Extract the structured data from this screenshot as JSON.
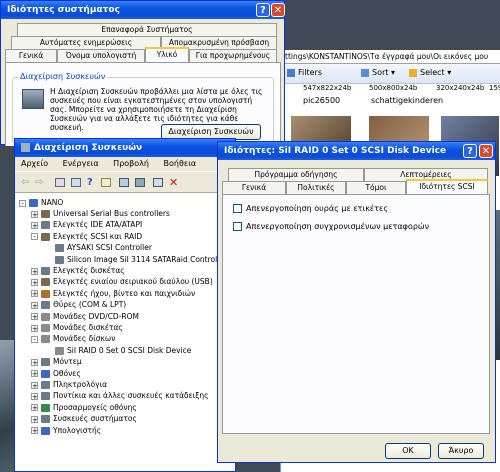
{
  "explorer": {
    "address": "ttings\\KONSTANTINOS\\Τα έγγραφά μου\\Οι εικόνες μου",
    "toolbar": {
      "filters": "Filters",
      "sort": "Sort",
      "select": "Select"
    },
    "thumbs": [
      {
        "size": "547x822x24b",
        "name": "pic26500"
      },
      {
        "size": "500x800x24b",
        "name": "schattigekinderen"
      },
      {
        "size": "320x240x24b",
        "name": ""
      },
      {
        "size": "159x",
        "name": ""
      }
    ]
  },
  "sysprops": {
    "title": "Ιδιότητες συστήματος",
    "tabs_row1": [
      "Επαναφορά Συστήματος"
    ],
    "tabs_row2": [
      "Αυτόματες ενημερώσεις",
      "Απομακρυσμένη πρόσβαση"
    ],
    "tabs_row3": [
      "Γενικά",
      "Όνομα υπολογιστή",
      "Υλικό",
      "Για προχωρημένους"
    ],
    "group_title": "Διαχείριση Συσκευών",
    "group_text": "Η Διαχείριση Συσκευών προβάλλει μια λίστα με όλες τις συσκευές που είναι εγκατεστημένες στον υπολογιστή σας. Μπορείτε να χρησιμοποιήσετε τη Διαχείριση Συσκευών για να αλλάξετε τις ιδιότητες για κάθε συσκευή.",
    "button": "Διαχείριση Συσκευών"
  },
  "devmgr": {
    "title": "Διαχείριση Συσκευών",
    "menu": [
      "Αρχείο",
      "Ενέργεια",
      "Προβολή",
      "Βοήθεια"
    ],
    "root": "NANO",
    "items": [
      {
        "label": "Universal Serial Bus controllers",
        "exp": "+",
        "depth": 1,
        "color": "#7a6a4a"
      },
      {
        "label": "Ελεγκτές IDE ATA/ATAPI",
        "exp": "+",
        "depth": 1,
        "color": "#6a7a8a"
      },
      {
        "label": "Ελεγκτές SCSI και RAID",
        "exp": "-",
        "depth": 1,
        "color": "#7a6a4a"
      },
      {
        "label": "AYSAKI SCSI Controller",
        "exp": "",
        "depth": 2,
        "color": "#6a7a8a"
      },
      {
        "label": "Silicon Image SiI 3114 SATARaid Controller",
        "exp": "",
        "depth": 2,
        "color": "#6a7a8a"
      },
      {
        "label": "Ελεγκτές δισκέτας",
        "exp": "+",
        "depth": 1,
        "color": "#6a7a8a"
      },
      {
        "label": "Ελεγκτές ενιαίου σειριακού διαύλου (USB)",
        "exp": "+",
        "depth": 1,
        "color": "#7a6a4a"
      },
      {
        "label": "Ελεγκτές ήχου, βίντεο και παιχνιδιών",
        "exp": "+",
        "depth": 1,
        "color": "#b0702a"
      },
      {
        "label": "Θύρες (COM & LPT)",
        "exp": "+",
        "depth": 1,
        "color": "#6a7a8a"
      },
      {
        "label": "Μονάδες DVD/CD-ROM",
        "exp": "+",
        "depth": 1,
        "color": "#8a8a8a"
      },
      {
        "label": "Μονάδες δισκέτας",
        "exp": "+",
        "depth": 1,
        "color": "#8a8a8a"
      },
      {
        "label": "Μονάδες δίσκων",
        "exp": "-",
        "depth": 1,
        "color": "#8a8a8a"
      },
      {
        "label": "SiI RAID 0 Set 0 SCSI Disk Device",
        "exp": "",
        "depth": 2,
        "color": "#8a8a8a"
      },
      {
        "label": "Μόντεμ",
        "exp": "+",
        "depth": 1,
        "color": "#6a7a8a"
      },
      {
        "label": "Οθόνες",
        "exp": "+",
        "depth": 1,
        "color": "#3a6ac0"
      },
      {
        "label": "Πληκτρολόγια",
        "exp": "+",
        "depth": 1,
        "color": "#6a7a8a"
      },
      {
        "label": "Ποντίκια και άλλες συσκευές κατάδειξης",
        "exp": "+",
        "depth": 1,
        "color": "#6a7a8a"
      },
      {
        "label": "Προσαρμογείς οθόνης",
        "exp": "+",
        "depth": 1,
        "color": "#3a8a4a"
      },
      {
        "label": "Συσκευές συστήματος",
        "exp": "+",
        "depth": 1,
        "color": "#6a7a8a"
      },
      {
        "label": "Υπολογιστής",
        "exp": "+",
        "depth": 1,
        "color": "#3a6ac0"
      }
    ]
  },
  "diskprops": {
    "title": "Ιδιότητες: SiI RAID 0 Set 0 SCSI Disk Device",
    "tabs_row1": [
      "Πρόγραμμα οδήγησης",
      "Λεπτομέρειες"
    ],
    "tabs_row2": [
      "Γενικά",
      "Πολιτικές",
      "Τόμοι",
      "Ιδιότητες SCSI"
    ],
    "check1": "Απενεργοποίηση ουράς με ετικέτες",
    "check2": "Απενεργοποίηση συγχρονισμένων μεταφορών",
    "ok": "OK",
    "cancel": "Άκυρο"
  }
}
